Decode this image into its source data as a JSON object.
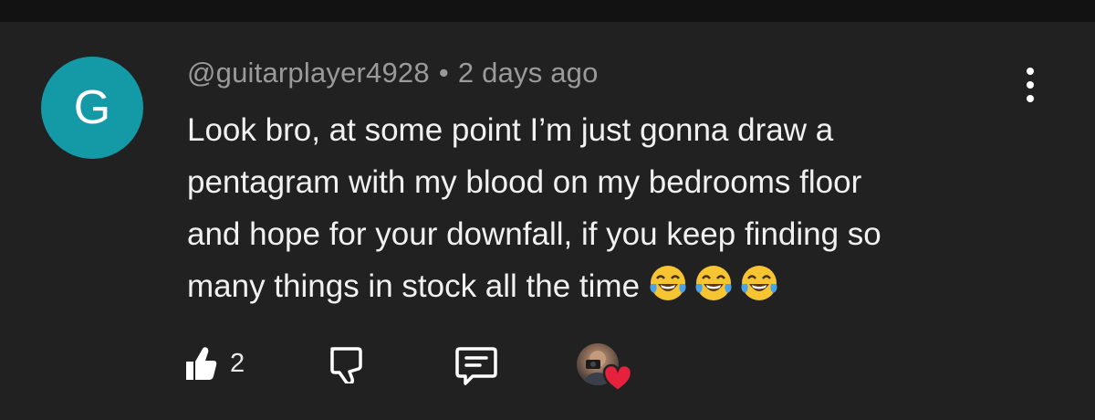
{
  "comment": {
    "avatar_letter": "G",
    "author": "@guitarplayer4928",
    "separator": "•",
    "timestamp": "2 days ago",
    "text_lines": [
      "Look bro, at some point I’m just gonna draw a",
      "pentagram with my blood on my bedrooms floor",
      "and hope for your downfall, if you keep finding so",
      "many things in stock all the time"
    ],
    "emoji": "😂😂😂",
    "like_count": "2"
  },
  "colors": {
    "background": "#212121",
    "top_strip": "#121212",
    "avatar_bg": "#1499a6",
    "meta_text": "#9a9a9a",
    "body_text": "#f1f1f1",
    "heart": "#e5213d"
  },
  "icons": {
    "like": "thumbs-up-icon",
    "dislike": "thumbs-down-icon",
    "reply": "reply-comment-icon",
    "more": "more-vertical-icon",
    "creator_heart": "heart-icon"
  }
}
